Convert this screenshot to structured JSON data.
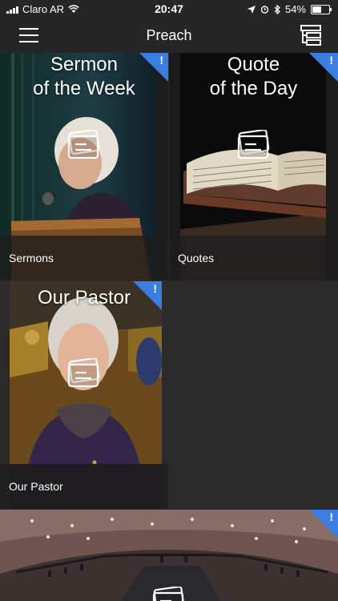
{
  "status": {
    "carrier": "Claro AR",
    "time": "20:47",
    "battery": "54%",
    "battery_level": 0.54
  },
  "nav": {
    "title": "Preach"
  },
  "tiles": [
    {
      "title_line1": "Sermon",
      "title_line2": "of the Week",
      "label": "Sermons",
      "badge": "!"
    },
    {
      "title_line1": "Quote",
      "title_line2": "of the Day",
      "label": "Quotes",
      "badge": "!"
    },
    {
      "title_line1": "Our Pastor",
      "label": "Our Pastor",
      "badge": "!"
    },
    {
      "badge": "!"
    }
  ],
  "colors": {
    "background": "#2b2b2b",
    "bar": "#262626",
    "badge": "#3b7de0"
  }
}
